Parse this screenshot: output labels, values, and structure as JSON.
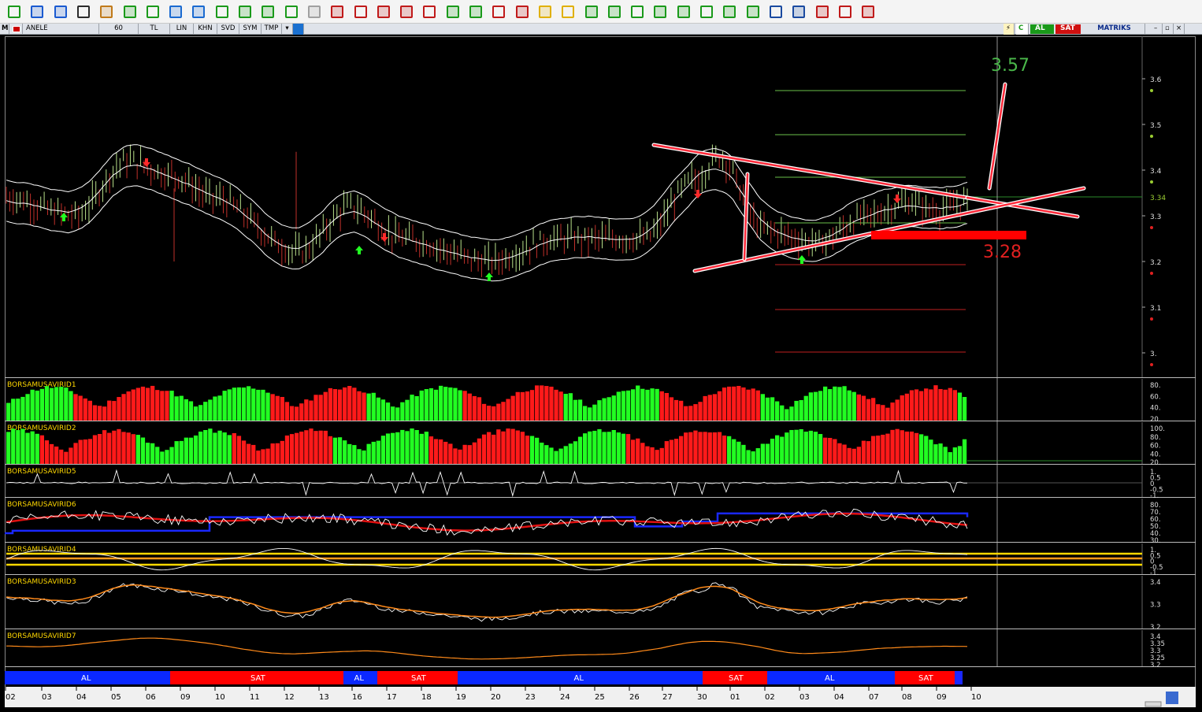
{
  "toolbar": {
    "icons": [
      "hand-icon",
      "arrow-cursor-icon",
      "crosshair-icon",
      "edit-icon",
      "tools-icon",
      "pencil-icon",
      "pencil-alt-icon",
      "channel-icon",
      "channel-alt-icon",
      "horizontal-line-icon",
      "vertical-line-icon",
      "trendline-icon",
      "trendline-alt-icon",
      "ray-icon",
      "fib-icon",
      "fib-alt-icon",
      "fib-fan-icon",
      "fib-arc-icon",
      "fib-time-icon",
      "gann-icon",
      "gann-alt-icon",
      "text-icon",
      "note-icon",
      "bell-icon",
      "alarm-icon",
      "arrows-expand-icon",
      "cross-icon",
      "arrows-vertical-icon",
      "asterisk-icon",
      "arrow-left-icon",
      "arrow-right-icon",
      "arrow-up-icon",
      "arrow-down-icon",
      "zoom-icon",
      "zoom-alt-icon",
      "checkbox-icon",
      "triangle-icon",
      "magnet-icon"
    ]
  },
  "symbar": {
    "market": "M",
    "symbol": "ANELE",
    "period": "60",
    "currency": "TL",
    "buttons": [
      "LIN",
      "KHN",
      "SVD",
      "SYM",
      "TMP"
    ],
    "mode_c": "C",
    "buy_label": "AL",
    "sell_label": "SAT",
    "brand": "MATRIKS"
  },
  "main_chart": {
    "price_axis": [
      "3.6",
      "3.5",
      "3.4",
      "3.3",
      "3.2",
      "3.1",
      "3."
    ],
    "last_price": "3.34",
    "target_up": "3.57",
    "target_down": "3.28"
  },
  "panels": [
    {
      "id": "p1",
      "label": "BORSAMUSAVIRID1",
      "scale": [
        "80.",
        "60.",
        "40.",
        "20."
      ]
    },
    {
      "id": "p2",
      "label": "BORSAMUSAVIRID2",
      "scale": [
        "100.",
        "80.",
        "60.",
        "40.",
        "20."
      ]
    },
    {
      "id": "p3",
      "label": "BORSAMUSAVIRID5",
      "scale": [
        "1.",
        "0.5",
        "0",
        "-0.5",
        "-1."
      ]
    },
    {
      "id": "p4",
      "label": "BORSAMUSAVIRID6",
      "scale": [
        "80.",
        "70.",
        "60.",
        "50.",
        "40.",
        "30."
      ]
    },
    {
      "id": "p5",
      "label": "BORSAMUSAVIRID4",
      "scale": [
        "1.",
        "0.5",
        "0",
        "-0.5",
        "-1."
      ]
    },
    {
      "id": "p6",
      "label": "BORSAMUSAVIRID3",
      "scale": [
        "3.4",
        "3.3",
        "3.2"
      ]
    },
    {
      "id": "p7",
      "label": "BORSAMUSAVIRID7",
      "scale": [
        "3.4",
        "3.35",
        "3.3",
        "3.25",
        "3.2"
      ]
    }
  ],
  "signal_bar": [
    {
      "label": "AL",
      "color": "#0a28ff"
    },
    {
      "label": "SAT",
      "color": "#ff0000"
    },
    {
      "label": "AL",
      "color": "#0a28ff"
    },
    {
      "label": "SAT",
      "color": "#ff0000"
    },
    {
      "label": "AL",
      "color": "#0a28ff"
    },
    {
      "label": "SAT",
      "color": "#ff0000"
    },
    {
      "label": "AL",
      "color": "#0a28ff"
    },
    {
      "label": "SAT",
      "color": "#ff0000"
    }
  ],
  "date_axis": [
    "02",
    "03",
    "04",
    "05",
    "06",
    "09",
    "10",
    "11",
    "12",
    "13",
    "16",
    "17",
    "18",
    "19",
    "20",
    "23",
    "24",
    "25",
    "26",
    "27",
    "30",
    "01",
    "02",
    "03",
    "04",
    "07",
    "08",
    "09",
    "10"
  ],
  "colors": {
    "up_bar": "#b8e08a",
    "down_bar": "#c0302a",
    "histo_green": "#22ff22",
    "histo_red": "#ff1a1a",
    "trendline": "#ff2a3a",
    "label_yellow": "#ffd800",
    "blue": "#1a28ff",
    "orange": "#ff8a1a"
  }
}
